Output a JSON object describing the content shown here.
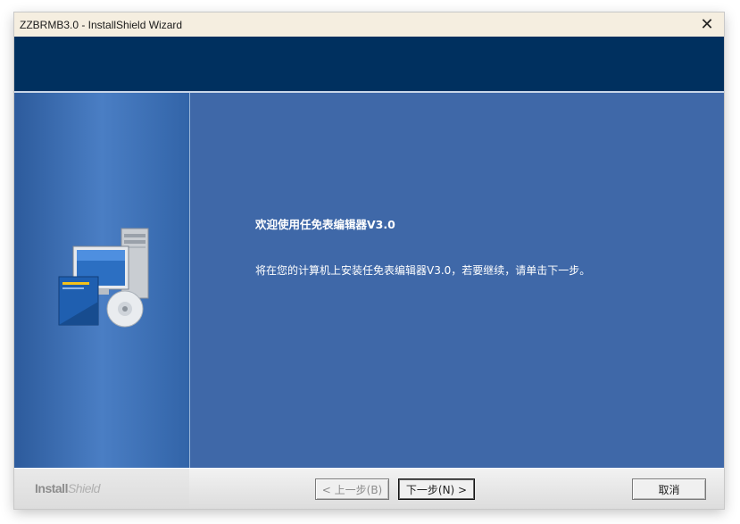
{
  "window": {
    "title": "ZZBRMB3.0 - InstallShield Wizard",
    "close_symbol": "✕"
  },
  "content": {
    "welcome_title": "欢迎使用任免表编辑器V3.0",
    "welcome_text": "将在您的计算机上安装任免表编辑器V3.0，若要继续，请单击下一步。"
  },
  "footer": {
    "logo_bold": "Install",
    "logo_light": "Shield",
    "back_label": "< 上一步(B)",
    "next_label": "下一步(N) >",
    "cancel_label": "取消"
  },
  "colors": {
    "banner": "#00305f",
    "body": "#3f68a8",
    "titlebar": "#f5eee0"
  },
  "icons": {
    "graphic": "computer-install-icon"
  }
}
